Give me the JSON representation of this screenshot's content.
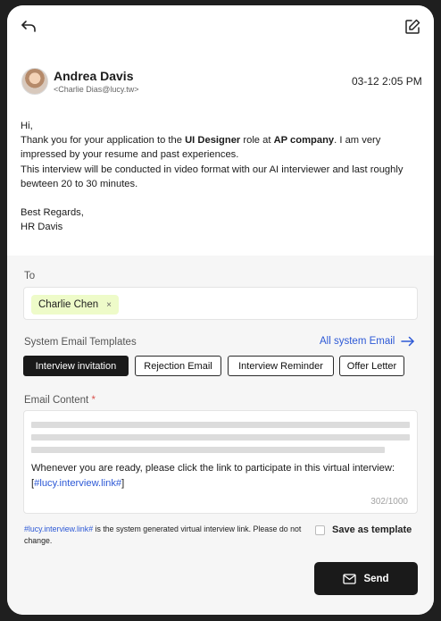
{
  "header": {
    "back_icon": "back-arrow-icon",
    "edit_icon": "edit-square-icon"
  },
  "email": {
    "sender_name": "Andrea Davis",
    "sender_email": "<Charlie Dias@lucy.tw>",
    "timestamp": "03-12 2:05 PM",
    "greeting": "Hi,",
    "line1_pre": "Thank you for your application to the ",
    "role": "UI Designer",
    "line1_mid": " role at ",
    "company": "AP company",
    "line1_post": ". I am very impressed by your resume and past experiences.",
    "line2": "This interview will be conducted in video format with our AI interviewer and last roughly bewteen 20 to 30 minutes.",
    "signoff": "Best Regards,",
    "signature": "HR Davis"
  },
  "compose": {
    "to_label": "To",
    "recipients": [
      "Charlie Chen"
    ],
    "chip_close": "×",
    "templates_label": "System Email Templates",
    "all_templates_link": "All system Email",
    "templates": [
      "Interview invitation",
      "Rejection Email",
      "Interview Reminder",
      "Offer Letter"
    ],
    "active_template": "Interview invitation",
    "content_label": "Email Content",
    "required_mark": "*",
    "content_text_pre": "Whenever you are ready, please click the link  to participate in this virtual interview: [",
    "content_link": "#lucy.interview.link#",
    "content_text_post": "]",
    "char_count": "302/1000",
    "note_link": "#lucy.interview.link#",
    "note_text": " is the system generated virtual interview link. Please do not change.",
    "save_template_label": "Save as template",
    "save_template_checked": false,
    "send_label": "Send"
  },
  "colors": {
    "accent_link": "#2d59d6",
    "chip_bg": "#eefbc9",
    "primary_button": "#1a1a1a"
  }
}
